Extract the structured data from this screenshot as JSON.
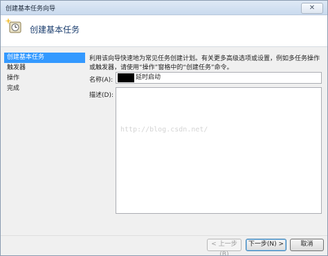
{
  "window": {
    "title": "创建基本任务向导",
    "close_glyph": "✕"
  },
  "header": {
    "title": "创建基本任务",
    "icon": "clock-sparkle-icon"
  },
  "sidebar": {
    "items": [
      {
        "label": "创建基本任务",
        "active": true
      },
      {
        "label": "触发器",
        "active": false
      },
      {
        "label": "操作",
        "active": false
      },
      {
        "label": "完成",
        "active": false
      }
    ]
  },
  "main": {
    "description": "利用该向导快速地为常见任务创建计划。有关更多高级选项或设置，例如多任务操作或触发器，请使用“操作”窗格中的“创建任务”命令。",
    "name_label": "名称(A):",
    "name_value": "延时启动",
    "desc_label": "描述(D):",
    "desc_value": "",
    "watermark": "http://blog.csdn.net/"
  },
  "buttons": {
    "prev": "< 上一步(B)",
    "next": "下一步(N) >",
    "cancel": "取消"
  },
  "colors": {
    "accent": "#3399ff",
    "header_title": "#1a3d6e"
  }
}
